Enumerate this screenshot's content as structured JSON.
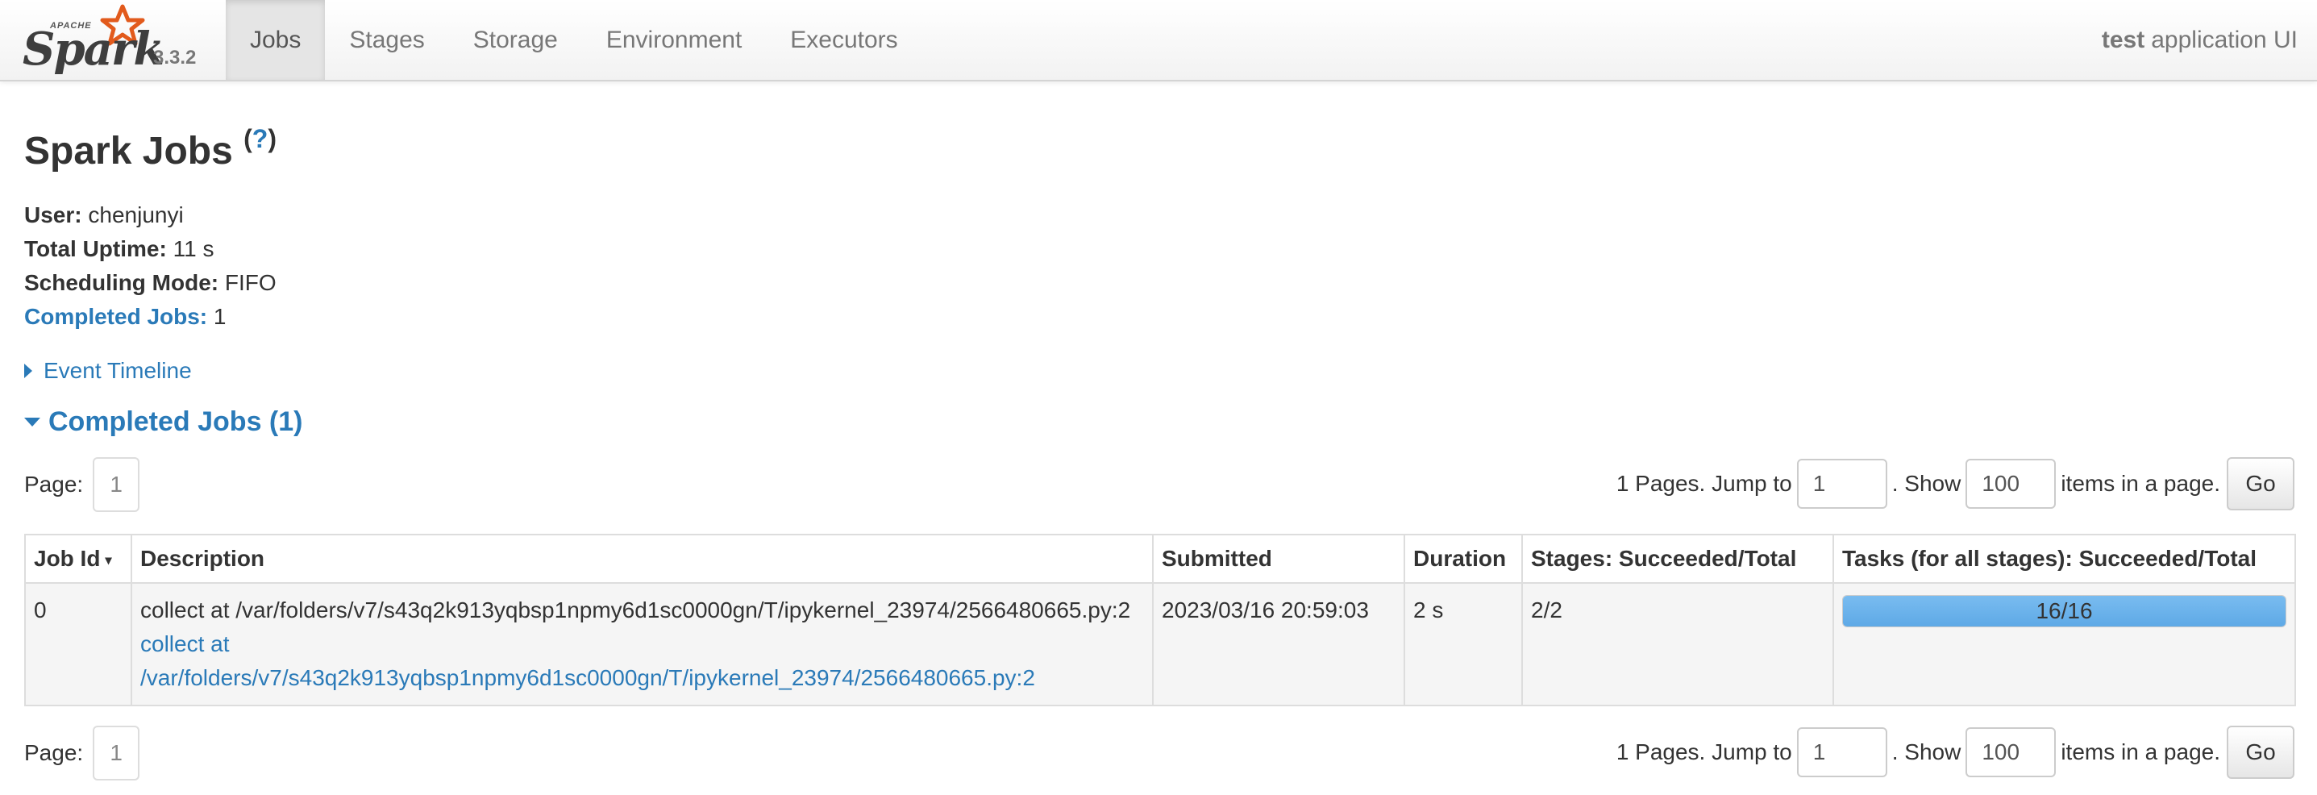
{
  "brand": {
    "apache": "APACHE",
    "word": "Spark",
    "version": "3.3.2"
  },
  "nav": {
    "tabs": [
      "Jobs",
      "Stages",
      "Storage",
      "Environment",
      "Executors"
    ],
    "active": "Jobs",
    "app_name_bold": "test",
    "app_name_rest": "application UI"
  },
  "page": {
    "title": "Spark Jobs",
    "help_open": "(",
    "help_q": "?",
    "help_close": ")"
  },
  "summary": {
    "user_label": "User:",
    "user_value": "chenjunyi",
    "uptime_label": "Total Uptime:",
    "uptime_value": "11 s",
    "mode_label": "Scheduling Mode:",
    "mode_value": "FIFO",
    "completed_label": "Completed Jobs:",
    "completed_value": "1"
  },
  "timeline_label": "Event Timeline",
  "section_label": "Completed Jobs (1)",
  "pagination": {
    "page_label": "Page:",
    "current_page": "1",
    "pages_text": "1 Pages. Jump to",
    "jump_value": "1",
    "show_text": ". Show",
    "show_value": "100",
    "items_text": "items in a page.",
    "go_label": "Go"
  },
  "table": {
    "headers": [
      "Job Id",
      "Description",
      "Submitted",
      "Duration",
      "Stages: Succeeded/Total",
      "Tasks (for all stages): Succeeded/Total"
    ],
    "sort_arrow": "▾",
    "rows": [
      {
        "job_id": "0",
        "description": "collect at /var/folders/v7/s43q2k913yqbsp1npmy6d1sc0000gn/T/ipykernel_23974/2566480665.py:2",
        "description_link_1": "collect at",
        "description_link_2": "/var/folders/v7/s43q2k913yqbsp1npmy6d1sc0000gn/T/ipykernel_23974/2566480665.py:2",
        "submitted": "2023/03/16 20:59:03",
        "duration": "2 s",
        "stages": "2/2",
        "tasks": "16/16",
        "tasks_fraction": 1.0
      }
    ]
  },
  "colors": {
    "link": "#2a7ab8",
    "progress": "#6fb3ec",
    "star": "#e25a1c"
  }
}
